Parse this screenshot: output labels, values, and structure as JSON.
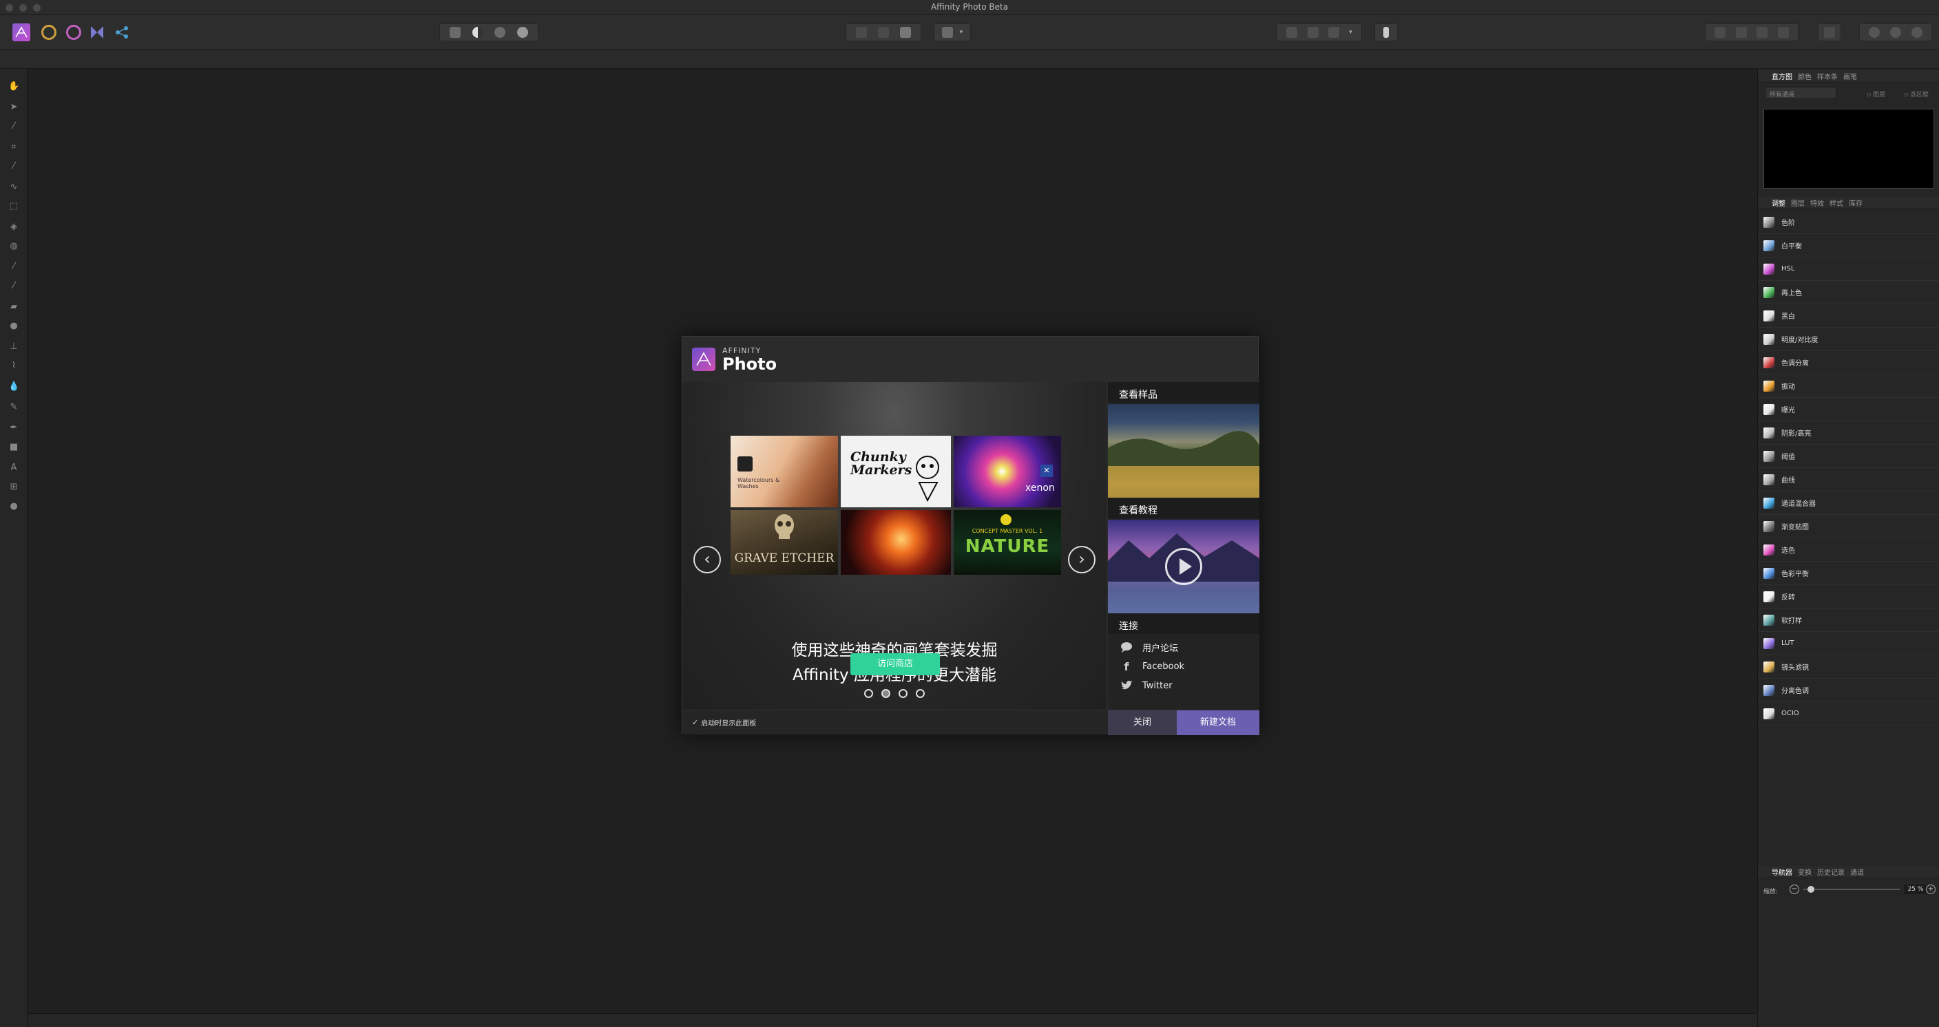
{
  "window": {
    "title": "Affinity Photo Beta"
  },
  "toolbar": {
    "personas": [
      "photo-persona-icon",
      "liquify-persona-icon",
      "develop-persona-icon",
      "tone-mapping-persona-icon",
      "export-persona-icon"
    ]
  },
  "histogram_panel": {
    "tabs": [
      "直方图",
      "颜色",
      "样本条",
      "画笔"
    ],
    "channel_select": "所有通道",
    "checkbox1": "图层",
    "checkbox2": "选区框"
  },
  "adjustments_panel": {
    "tabs": [
      "调整",
      "图层",
      "特效",
      "样式",
      "库存"
    ],
    "items": [
      {
        "label": "色阶",
        "color": "#8a8a8a"
      },
      {
        "label": "白平衡",
        "color": "#6ea1d9"
      },
      {
        "label": "HSL",
        "color": "#c84fd0"
      },
      {
        "label": "再上色",
        "color": "#4ab356"
      },
      {
        "label": "黑白",
        "color": "#e0e0e0"
      },
      {
        "label": "明度/对比度",
        "color": "#cfcfcf"
      },
      {
        "label": "色调分离",
        "color": "#d04040"
      },
      {
        "label": "振动",
        "color": "#e89a2a"
      },
      {
        "label": "曝光",
        "color": "#e8e8e8"
      },
      {
        "label": "阴影/高亮",
        "color": "#bdbdbd"
      },
      {
        "label": "阈值",
        "color": "#9a9a9a"
      },
      {
        "label": "曲线",
        "color": "#a8a8a8"
      },
      {
        "label": "通道混合器",
        "color": "#3fa4e0"
      },
      {
        "label": "渐变贴图",
        "color": "#777777"
      },
      {
        "label": "选色",
        "color": "#e050c0"
      },
      {
        "label": "色彩平衡",
        "color": "#4f90e0"
      },
      {
        "label": "反转",
        "color": "#f0f0f0"
      },
      {
        "label": "软打样",
        "color": "#5aa0a0"
      },
      {
        "label": "LUT",
        "color": "#8f6fe0"
      },
      {
        "label": "镜头滤镜",
        "color": "#e0b050"
      },
      {
        "label": "分离色调",
        "color": "#6080c0"
      },
      {
        "label": "OCIO",
        "color": "#dddddd"
      }
    ]
  },
  "navigator_panel": {
    "tabs": [
      "导航器",
      "变换",
      "历史记录",
      "通道"
    ],
    "zoom_label": "缩放:",
    "zoom_value": "25 %",
    "zoom_fraction": 0.25
  },
  "dialog": {
    "brand_top": "AFFINITY",
    "brand_bottom": "Photo",
    "headline_line1": "使用这些神奇的画笔套装发掘",
    "headline_line2": "Affinity 应用程序的更大潜能",
    "cta_button": "访问商店",
    "thumbnails": {
      "t1": "Watercolours & Washes",
      "t2": "Chunky Markers",
      "t3": "xenon",
      "t4": "GRAVE ETCHER",
      "t5": "",
      "t6": "NATURE",
      "t6_top": "CONCEPT MASTER VOL. 1"
    },
    "carousel_pages": 4,
    "carousel_active": 2,
    "side": {
      "samples_title": "查看样品",
      "tutorials_title": "查看教程",
      "connect_title": "连接",
      "links": [
        {
          "label": "用户论坛",
          "icon": "speech-bubble-icon"
        },
        {
          "label": "Facebook",
          "icon": "facebook-icon"
        },
        {
          "label": "Twitter",
          "icon": "twitter-icon"
        }
      ]
    },
    "footer": {
      "show_on_startup": "启动时显示此面板",
      "show_on_startup_checked": true,
      "close_button": "关闭",
      "new_doc_button": "新建文档"
    }
  },
  "colors": {
    "accent_green": "#2fd39a",
    "new_doc": "#6a5fb0",
    "close_btn": "#3f3b4e"
  }
}
